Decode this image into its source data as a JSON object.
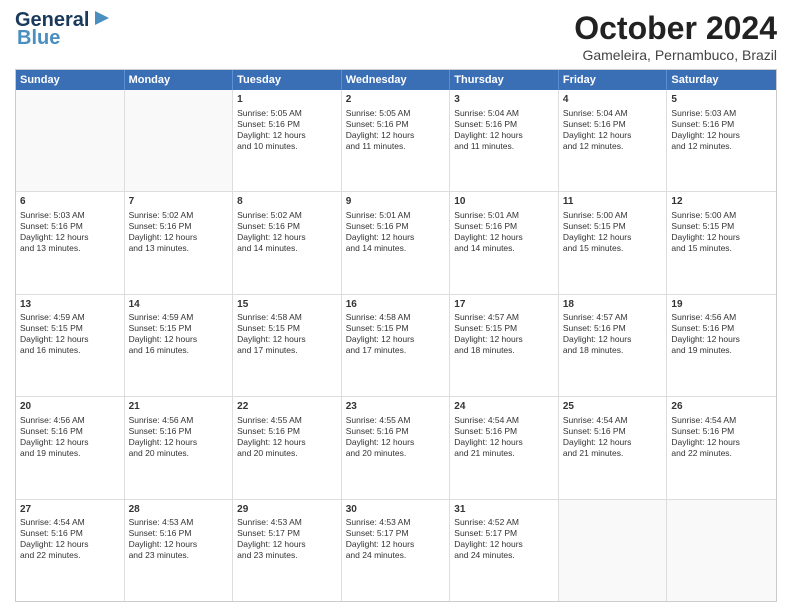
{
  "header": {
    "logo_line1": "General",
    "logo_line2": "Blue",
    "title": "October 2024",
    "subtitle": "Gameleira, Pernambuco, Brazil"
  },
  "calendar": {
    "days": [
      "Sunday",
      "Monday",
      "Tuesday",
      "Wednesday",
      "Thursday",
      "Friday",
      "Saturday"
    ],
    "rows": [
      [
        {
          "day": "",
          "text": ""
        },
        {
          "day": "",
          "text": ""
        },
        {
          "day": "1",
          "text": "Sunrise: 5:05 AM\nSunset: 5:16 PM\nDaylight: 12 hours\nand 10 minutes."
        },
        {
          "day": "2",
          "text": "Sunrise: 5:05 AM\nSunset: 5:16 PM\nDaylight: 12 hours\nand 11 minutes."
        },
        {
          "day": "3",
          "text": "Sunrise: 5:04 AM\nSunset: 5:16 PM\nDaylight: 12 hours\nand 11 minutes."
        },
        {
          "day": "4",
          "text": "Sunrise: 5:04 AM\nSunset: 5:16 PM\nDaylight: 12 hours\nand 12 minutes."
        },
        {
          "day": "5",
          "text": "Sunrise: 5:03 AM\nSunset: 5:16 PM\nDaylight: 12 hours\nand 12 minutes."
        }
      ],
      [
        {
          "day": "6",
          "text": "Sunrise: 5:03 AM\nSunset: 5:16 PM\nDaylight: 12 hours\nand 13 minutes."
        },
        {
          "day": "7",
          "text": "Sunrise: 5:02 AM\nSunset: 5:16 PM\nDaylight: 12 hours\nand 13 minutes."
        },
        {
          "day": "8",
          "text": "Sunrise: 5:02 AM\nSunset: 5:16 PM\nDaylight: 12 hours\nand 14 minutes."
        },
        {
          "day": "9",
          "text": "Sunrise: 5:01 AM\nSunset: 5:16 PM\nDaylight: 12 hours\nand 14 minutes."
        },
        {
          "day": "10",
          "text": "Sunrise: 5:01 AM\nSunset: 5:16 PM\nDaylight: 12 hours\nand 14 minutes."
        },
        {
          "day": "11",
          "text": "Sunrise: 5:00 AM\nSunset: 5:15 PM\nDaylight: 12 hours\nand 15 minutes."
        },
        {
          "day": "12",
          "text": "Sunrise: 5:00 AM\nSunset: 5:15 PM\nDaylight: 12 hours\nand 15 minutes."
        }
      ],
      [
        {
          "day": "13",
          "text": "Sunrise: 4:59 AM\nSunset: 5:15 PM\nDaylight: 12 hours\nand 16 minutes."
        },
        {
          "day": "14",
          "text": "Sunrise: 4:59 AM\nSunset: 5:15 PM\nDaylight: 12 hours\nand 16 minutes."
        },
        {
          "day": "15",
          "text": "Sunrise: 4:58 AM\nSunset: 5:15 PM\nDaylight: 12 hours\nand 17 minutes."
        },
        {
          "day": "16",
          "text": "Sunrise: 4:58 AM\nSunset: 5:15 PM\nDaylight: 12 hours\nand 17 minutes."
        },
        {
          "day": "17",
          "text": "Sunrise: 4:57 AM\nSunset: 5:15 PM\nDaylight: 12 hours\nand 18 minutes."
        },
        {
          "day": "18",
          "text": "Sunrise: 4:57 AM\nSunset: 5:16 PM\nDaylight: 12 hours\nand 18 minutes."
        },
        {
          "day": "19",
          "text": "Sunrise: 4:56 AM\nSunset: 5:16 PM\nDaylight: 12 hours\nand 19 minutes."
        }
      ],
      [
        {
          "day": "20",
          "text": "Sunrise: 4:56 AM\nSunset: 5:16 PM\nDaylight: 12 hours\nand 19 minutes."
        },
        {
          "day": "21",
          "text": "Sunrise: 4:56 AM\nSunset: 5:16 PM\nDaylight: 12 hours\nand 20 minutes."
        },
        {
          "day": "22",
          "text": "Sunrise: 4:55 AM\nSunset: 5:16 PM\nDaylight: 12 hours\nand 20 minutes."
        },
        {
          "day": "23",
          "text": "Sunrise: 4:55 AM\nSunset: 5:16 PM\nDaylight: 12 hours\nand 20 minutes."
        },
        {
          "day": "24",
          "text": "Sunrise: 4:54 AM\nSunset: 5:16 PM\nDaylight: 12 hours\nand 21 minutes."
        },
        {
          "day": "25",
          "text": "Sunrise: 4:54 AM\nSunset: 5:16 PM\nDaylight: 12 hours\nand 21 minutes."
        },
        {
          "day": "26",
          "text": "Sunrise: 4:54 AM\nSunset: 5:16 PM\nDaylight: 12 hours\nand 22 minutes."
        }
      ],
      [
        {
          "day": "27",
          "text": "Sunrise: 4:54 AM\nSunset: 5:16 PM\nDaylight: 12 hours\nand 22 minutes."
        },
        {
          "day": "28",
          "text": "Sunrise: 4:53 AM\nSunset: 5:16 PM\nDaylight: 12 hours\nand 23 minutes."
        },
        {
          "day": "29",
          "text": "Sunrise: 4:53 AM\nSunset: 5:17 PM\nDaylight: 12 hours\nand 23 minutes."
        },
        {
          "day": "30",
          "text": "Sunrise: 4:53 AM\nSunset: 5:17 PM\nDaylight: 12 hours\nand 24 minutes."
        },
        {
          "day": "31",
          "text": "Sunrise: 4:52 AM\nSunset: 5:17 PM\nDaylight: 12 hours\nand 24 minutes."
        },
        {
          "day": "",
          "text": ""
        },
        {
          "day": "",
          "text": ""
        }
      ]
    ]
  }
}
